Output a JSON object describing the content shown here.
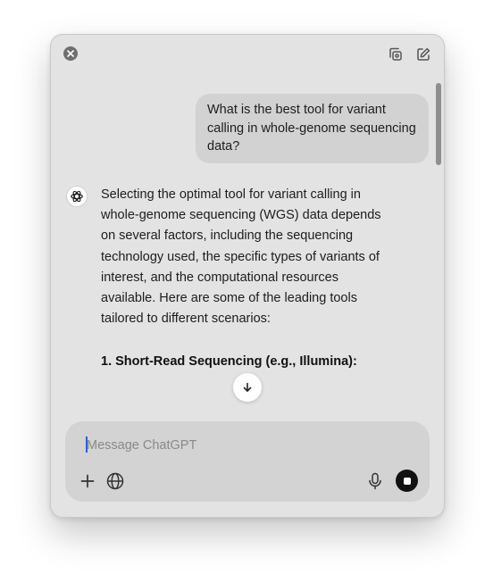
{
  "user_message": {
    "text": "What is the best tool for variant calling in whole-genome sequencing data?"
  },
  "assistant_message": {
    "paragraph": "Selecting the optimal tool for variant calling in whole-genome sequencing (WGS) data depends on several factors, including the sequencing technology used, the specific types of variants of interest, and the computational resources available. Here are some of the leading tools tailored to different scenarios:",
    "heading": "1. Short-Read Sequencing (e.g., Illumina):"
  },
  "composer": {
    "placeholder": "Message ChatGPT",
    "value": ""
  },
  "icons": {
    "close": "close-icon",
    "screenshot": "capture-window-icon",
    "new_chat": "compose-icon",
    "assistant": "chatgpt-logo-icon",
    "scroll_down": "arrow-down-icon",
    "attach": "plus-icon",
    "web": "globe-icon",
    "voice": "microphone-icon",
    "stop": "stop-icon"
  },
  "colors": {
    "window_bg": "#e3e3e3",
    "user_bubble": "#d2d2d2",
    "composer_bg": "#d3d3d3",
    "stop_button": "#111111",
    "caret": "#2a62d9"
  }
}
